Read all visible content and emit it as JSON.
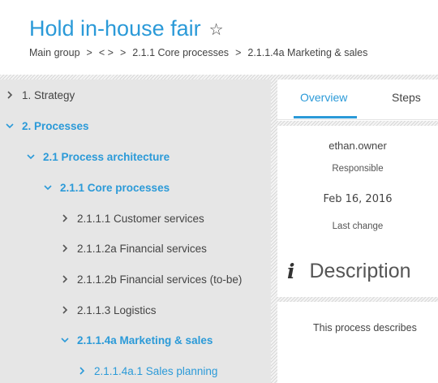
{
  "header": {
    "title": "Hold in-house fair",
    "breadcrumb": [
      "Main group",
      "< >",
      "2.1.1 Core processes",
      "2.1.1.4a Marketing & sales"
    ],
    "breadcrumb_sep": ">"
  },
  "tree": [
    {
      "label": "1. Strategy",
      "state": "collapsed"
    },
    {
      "label": "2. Processes",
      "state": "expanded"
    },
    {
      "label": "2.1 Process architecture",
      "state": "expanded"
    },
    {
      "label": "2.1.1 Core processes",
      "state": "expanded"
    },
    {
      "label": "2.1.1.1 Customer services",
      "state": "collapsed"
    },
    {
      "label": "2.1.1.2a Financial services",
      "state": "collapsed"
    },
    {
      "label": "2.1.1.2b Financial services (to-be)",
      "state": "collapsed"
    },
    {
      "label": "2.1.1.3 Logistics",
      "state": "collapsed"
    },
    {
      "label": "2.1.1.4a Marketing & sales",
      "state": "expanded"
    },
    {
      "label": "2.1.1.4a.1 Sales planning",
      "state": "collapsed"
    }
  ],
  "tabs": [
    {
      "label": "Overview",
      "active": true
    },
    {
      "label": "Steps",
      "active": false
    }
  ],
  "overview": {
    "responsible_value": "ethan.owner",
    "responsible_label": "Responsible",
    "last_change_value": "Feb 16, 2016",
    "last_change_label": "Last change"
  },
  "description": {
    "title": "Description",
    "text": "This process describes"
  },
  "colors": {
    "accent": "#2b9ad8",
    "sidebar_bg": "#e6e6e6"
  },
  "icons": {
    "favorite": "star-outline-icon",
    "info": "info-icon",
    "collapsed": "chevron-right-icon",
    "expanded": "chevron-down-icon"
  }
}
